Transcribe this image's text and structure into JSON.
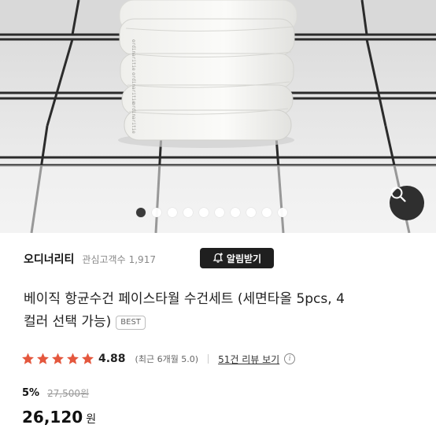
{
  "gallery": {
    "towel_brand_print": "ordinaritie",
    "slide_count": 10,
    "active_slide": 1
  },
  "shop": {
    "name": "오디너리티",
    "follower_label": "관심고객수",
    "follower_count": "1,917",
    "alarm_button_label": "알림받기"
  },
  "product": {
    "title_line1": "베이직 항균수건 페이스타월 수건세트 (세면타올 5pcs, 4",
    "title_line2": "컬러 선택 가능)",
    "badge": "BEST"
  },
  "rating": {
    "score": "4.88",
    "stars": 5,
    "recent_text": "(최근 6개월 5.0)",
    "review_link": "51건 리뷰 보기"
  },
  "price": {
    "discount": "5%",
    "original": "27,500원",
    "sale": "26,120",
    "currency": "원"
  },
  "colors": {
    "star": "#e4573d",
    "dark_button": "#1f1f1f"
  }
}
